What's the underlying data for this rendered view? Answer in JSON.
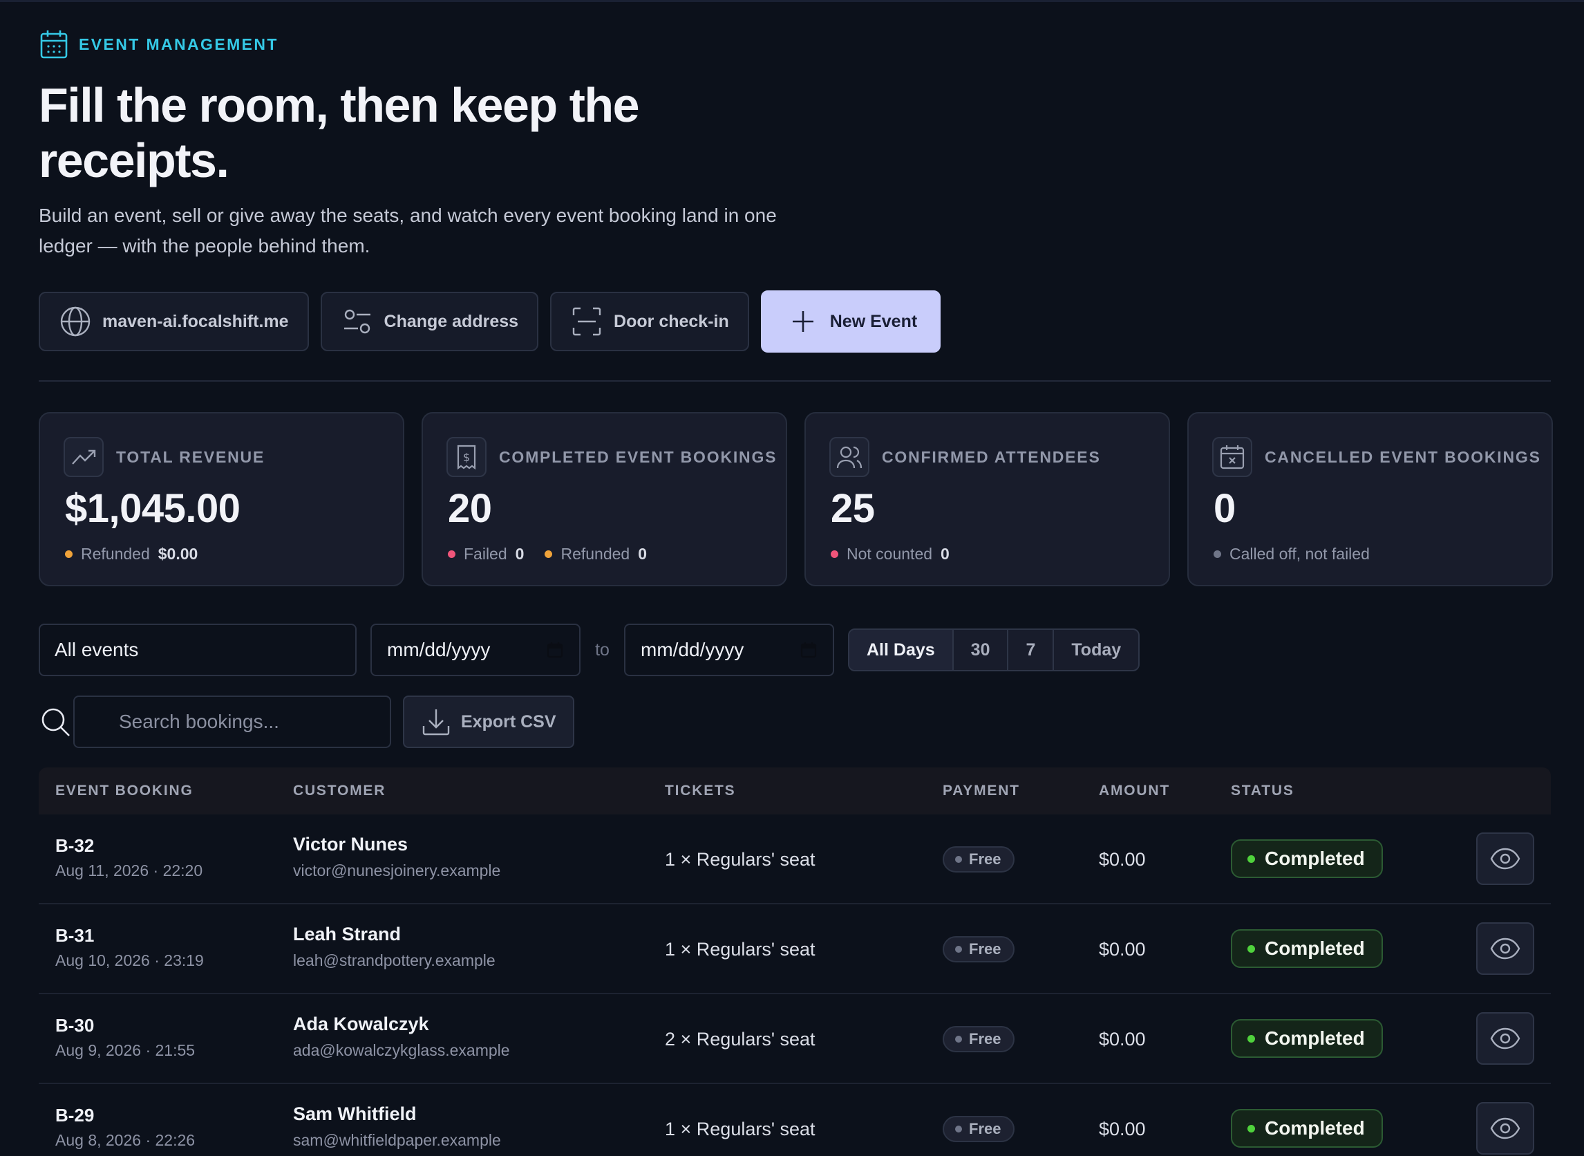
{
  "header": {
    "eyebrow": "EVENT MANAGEMENT",
    "title": "Fill the room, then keep the receipts.",
    "subtitle": "Build an event, sell or give away the seats, and watch every event booking land in one ledger — with the people behind them."
  },
  "actions": {
    "domain": "maven-ai.focalshift.me",
    "change_address": "Change address",
    "door_checkin": "Door check-in",
    "new_event": "New Event"
  },
  "stats": [
    {
      "label": "TOTAL REVENUE",
      "value": "$1,045.00",
      "meta": [
        {
          "label": "Refunded",
          "value": "$0.00",
          "color": "#f0a33a"
        }
      ]
    },
    {
      "label": "COMPLETED EVENT BOOKINGS",
      "value": "20",
      "meta": [
        {
          "label": "Failed",
          "value": "0",
          "color": "#f0557a"
        },
        {
          "label": "Refunded",
          "value": "0",
          "color": "#f0a33a"
        }
      ]
    },
    {
      "label": "CONFIRMED ATTENDEES",
      "value": "25",
      "meta": [
        {
          "label": "Not counted",
          "value": "0",
          "color": "#f0557a"
        }
      ]
    },
    {
      "label": "CANCELLED EVENT BOOKINGS",
      "value": "0",
      "meta": [
        {
          "label": "Called off, not failed",
          "value": "",
          "color": "#6f7588"
        }
      ]
    }
  ],
  "filters": {
    "event_select": "All events",
    "date_from": "mm/dd/yyyy",
    "date_sep": "to",
    "date_to": "mm/dd/yyyy",
    "ranges": [
      "All Days",
      "30",
      "7",
      "Today"
    ],
    "search_placeholder": "Search bookings...",
    "export": "Export CSV"
  },
  "table": {
    "columns": [
      "EVENT BOOKING",
      "CUSTOMER",
      "TICKETS",
      "PAYMENT",
      "AMOUNT",
      "STATUS"
    ],
    "rows": [
      {
        "id": "B-32",
        "date": "Aug 11, 2026 · 22:20",
        "name": "Victor Nunes",
        "email": "victor@nunesjoinery.example",
        "tickets": "1 × Regulars' seat",
        "payment": "Free",
        "amount": "$0.00",
        "status": "Completed"
      },
      {
        "id": "B-31",
        "date": "Aug 10, 2026 · 23:19",
        "name": "Leah Strand",
        "email": "leah@strandpottery.example",
        "tickets": "1 × Regulars' seat",
        "payment": "Free",
        "amount": "$0.00",
        "status": "Completed"
      },
      {
        "id": "B-30",
        "date": "Aug 9, 2026 · 21:55",
        "name": "Ada Kowalczyk",
        "email": "ada@kowalczykglass.example",
        "tickets": "2 × Regulars' seat",
        "payment": "Free",
        "amount": "$0.00",
        "status": "Completed"
      },
      {
        "id": "B-29",
        "date": "Aug 8, 2026 · 22:26",
        "name": "Sam Whitfield",
        "email": "sam@whitfieldpaper.example",
        "tickets": "1 × Regulars' seat",
        "payment": "Free",
        "amount": "$0.00",
        "status": "Completed"
      }
    ]
  },
  "colors": {
    "accent": "#35c9e6",
    "primary_button": "#c9cdfb",
    "status_green": "#4fd23c"
  }
}
